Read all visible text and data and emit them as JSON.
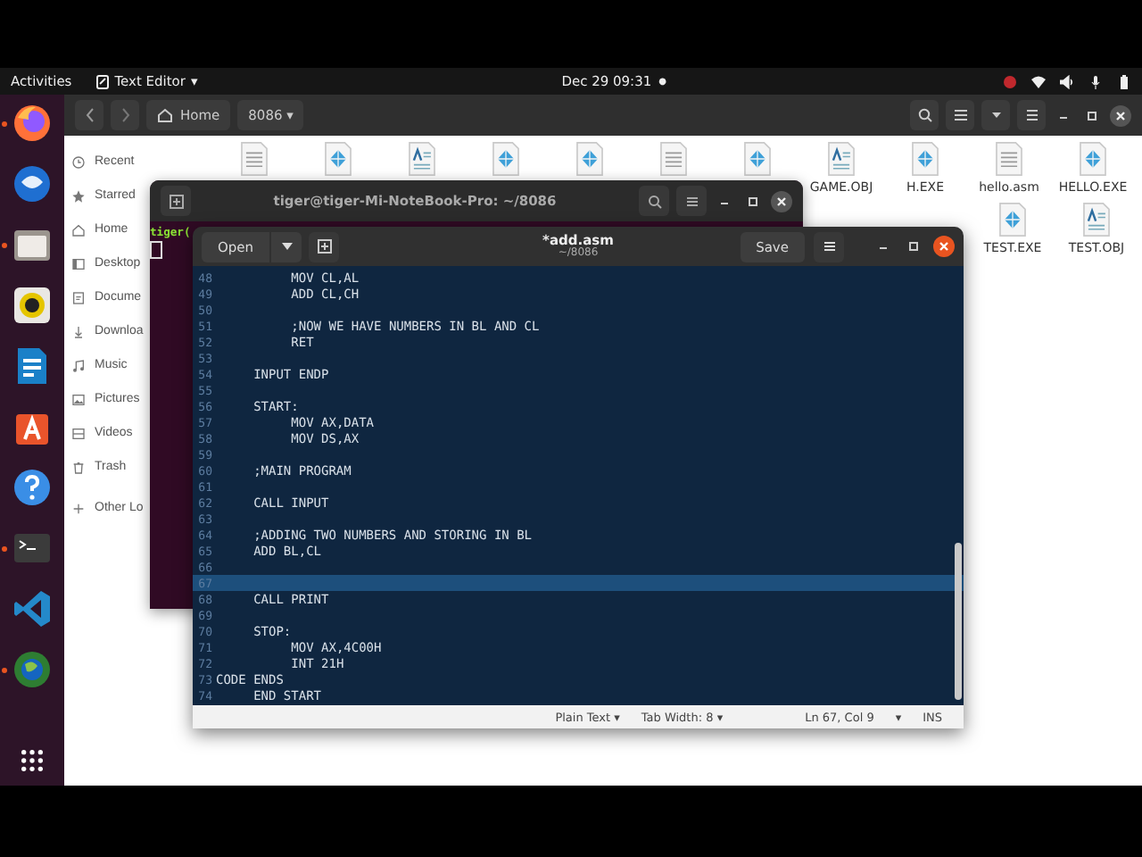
{
  "top_bar": {
    "activities": "Activities",
    "app_menu": "Text Editor",
    "app_menu_arrow": "▾",
    "clock": "Dec 29  09:31",
    "clock_dot": "●"
  },
  "dock": [
    {
      "kind": "firefox",
      "running": true
    },
    {
      "kind": "mail",
      "running": false
    },
    {
      "kind": "files",
      "running": true
    },
    {
      "kind": "music",
      "running": false
    },
    {
      "kind": "writer",
      "running": false
    },
    {
      "kind": "store",
      "running": false
    },
    {
      "kind": "help",
      "running": false
    },
    {
      "kind": "terminal",
      "running": true
    },
    {
      "kind": "code",
      "running": false
    },
    {
      "kind": "globe",
      "running": true
    },
    {
      "kind": "apps",
      "running": false
    }
  ],
  "files": {
    "path": [
      {
        "label": "Home",
        "kind": "home"
      },
      {
        "label": "8086",
        "kind": "folder"
      }
    ],
    "path_arrow": "▾",
    "sidebar": [
      {
        "label": "Recent",
        "kind": "recent"
      },
      {
        "label": "Starred",
        "kind": "star"
      },
      {
        "label": "Home",
        "kind": "home"
      },
      {
        "label": "Desktop",
        "kind": "desktop"
      },
      {
        "label": "Docume",
        "kind": "doc"
      },
      {
        "label": "Downloa",
        "kind": "download"
      },
      {
        "label": "Music",
        "kind": "music"
      },
      {
        "label": "Pictures",
        "kind": "picture"
      },
      {
        "label": "Videos",
        "kind": "video"
      },
      {
        "label": "Trash",
        "kind": "trash"
      },
      {
        "label": "Other Lo",
        "kind": "other"
      }
    ],
    "row_1": [
      {
        "kind": "text"
      },
      {
        "kind": "exe"
      },
      {
        "kind": "doc"
      },
      {
        "kind": "exe"
      },
      {
        "kind": "exe"
      },
      {
        "kind": "text"
      },
      {
        "kind": "exe"
      },
      {
        "kind": "doc",
        "name": "GAME.OBJ"
      },
      {
        "kind": "exe",
        "name": "H.EXE"
      },
      {
        "kind": "text",
        "name": "hello.asm"
      },
      {
        "kind": "exe",
        "name": "HELLO.EXE"
      }
    ],
    "row_2": [
      {
        "kind": "exe",
        "name": "TEST.EXE"
      },
      {
        "kind": "doc",
        "name": "TEST.OBJ"
      }
    ]
  },
  "terminal": {
    "title": "tiger@tiger-Mi-NoteBook-Pro: ~/8086",
    "prompt": "tiger("
  },
  "editor": {
    "open": "Open",
    "title": "*add.asm",
    "subtitle": "~/8086",
    "save": "Save",
    "lines": [
      {
        "number": "48",
        "text": "\t\tMOV CL,AL",
        "current": false
      },
      {
        "number": "49",
        "text": "\t\tADD CL,CH",
        "current": false
      },
      {
        "number": "50",
        "current": false
      },
      {
        "number": "51",
        "text": "\t\t;NOW WE HAVE NUMBERS IN BL AND CL",
        "current": false
      },
      {
        "number": "52",
        "text": "\t\tRET",
        "current": false
      },
      {
        "number": "53",
        "current": false
      },
      {
        "number": "54",
        "text": "\tINPUT ENDP",
        "current": false
      },
      {
        "number": "55",
        "current": false
      },
      {
        "number": "56",
        "text": "\tSTART:",
        "current": false
      },
      {
        "number": "57",
        "text": "\t\tMOV AX,DATA",
        "current": false
      },
      {
        "number": "58",
        "text": "\t\tMOV DS,AX",
        "current": false
      },
      {
        "number": "59",
        "current": false
      },
      {
        "number": "60",
        "text": "\t;MAIN PROGRAM",
        "current": false
      },
      {
        "number": "61",
        "current": false
      },
      {
        "number": "62",
        "text": "\tCALL INPUT",
        "current": false
      },
      {
        "number": "63",
        "current": false
      },
      {
        "number": "64",
        "text": "\t;ADDING TWO NUMBERS AND STORING IN BL",
        "current": false
      },
      {
        "number": "65",
        "text": "\tADD BL,CL",
        "current": false
      },
      {
        "number": "66",
        "current": false
      },
      {
        "number": "67",
        "current": true
      },
      {
        "number": "68",
        "text": "\tCALL PRINT",
        "current": false
      },
      {
        "number": "69",
        "current": false
      },
      {
        "number": "70",
        "text": "\tSTOP:",
        "current": false
      },
      {
        "number": "71",
        "text": "\t\tMOV AX,4C00H",
        "current": false
      },
      {
        "number": "72",
        "text": "\t\tINT 21H",
        "current": false
      },
      {
        "number": "73",
        "text": "CODE ENDS",
        "current": false
      },
      {
        "number": "74",
        "text": "\tEND START",
        "current": false
      }
    ],
    "status": {
      "language": "Plain Text",
      "tab_width": "Tab Width: 8",
      "position": "Ln 67, Col 9",
      "position_arrow": "▾",
      "mode": "INS",
      "arrow": "▾"
    }
  }
}
